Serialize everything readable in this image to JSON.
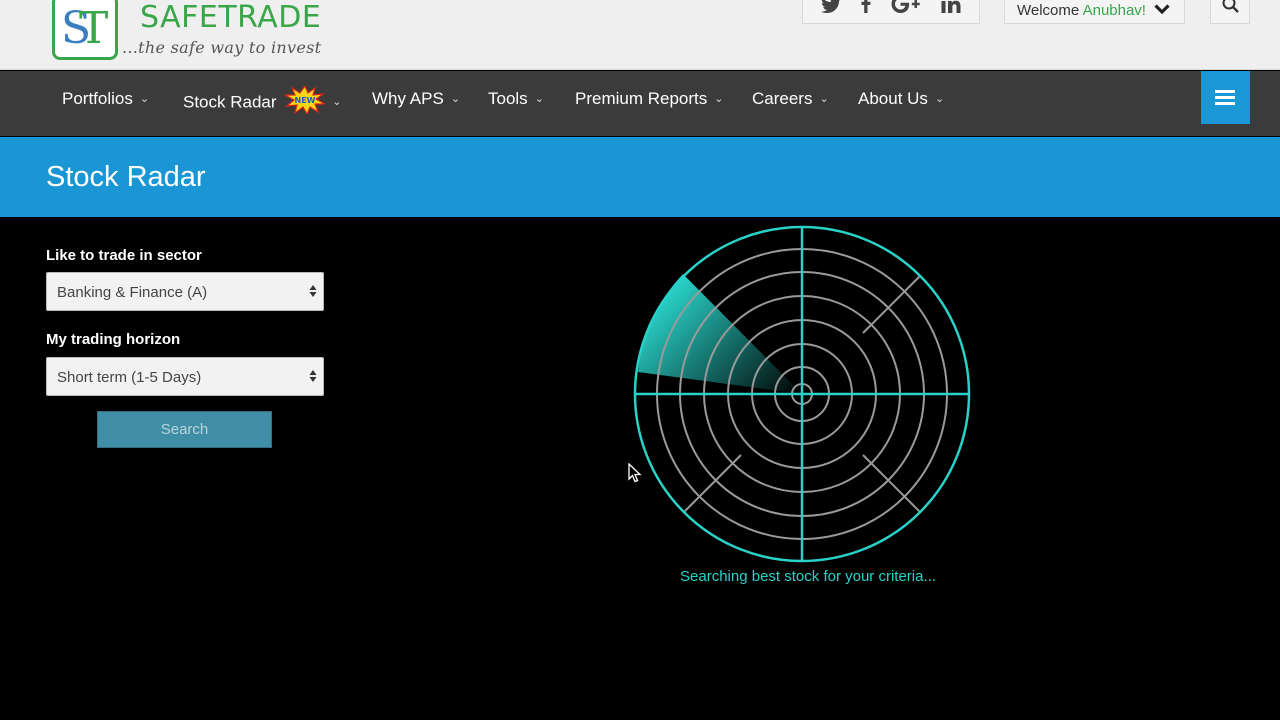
{
  "header": {
    "logo_title": "SAFETRADE",
    "logo_tagline": "...the safe way to invest",
    "social_icons": [
      "twitter-icon",
      "facebook-icon",
      "google-plus-icon",
      "linkedin-icon"
    ],
    "welcome_text": "Welcome",
    "user_name": "Anubhav!",
    "brand_green": "#3aa64a"
  },
  "nav": {
    "items": [
      {
        "label": "Portfolios"
      },
      {
        "label": "Stock Radar",
        "badge": "new"
      },
      {
        "label": "Why APS"
      },
      {
        "label": "Tools"
      },
      {
        "label": "Premium Reports"
      },
      {
        "label": "Careers"
      },
      {
        "label": "About Us"
      }
    ],
    "background": "#3b3b3b",
    "accent": "#1a98d6"
  },
  "page": {
    "title": "Stock Radar"
  },
  "form": {
    "sector_label": "Like to trade in sector",
    "sector_value": "Banking & Finance (A)",
    "horizon_label": "My trading horizon",
    "horizon_value": "Short term (1-5 Days)",
    "search_label": "Search"
  },
  "radar": {
    "caption": "Searching best stock for your criteria...",
    "color": "#29d2c8"
  }
}
